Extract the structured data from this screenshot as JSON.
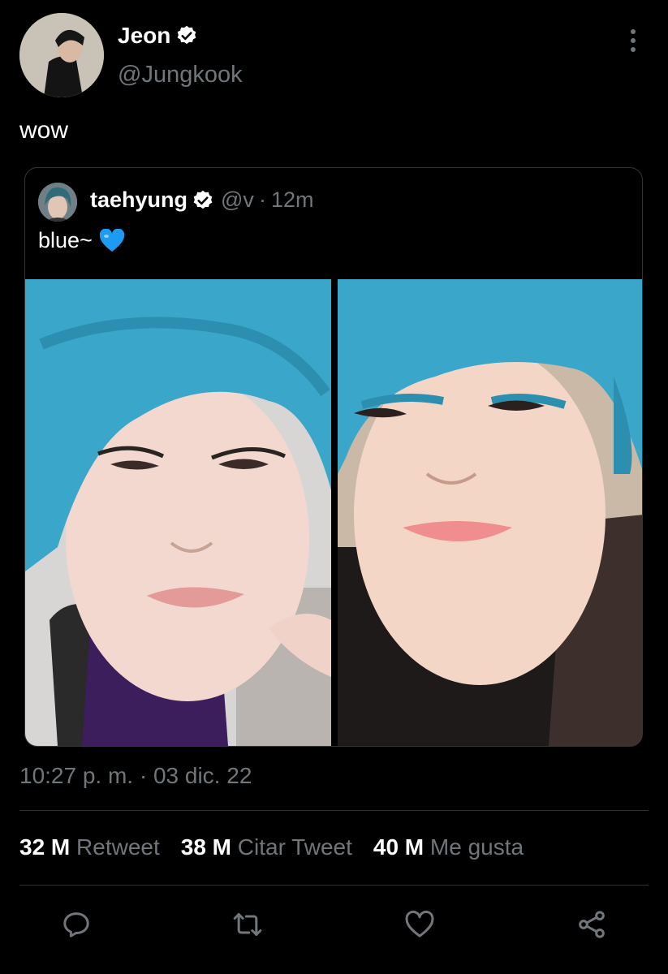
{
  "author": {
    "display_name": "Jeon",
    "handle": "@Jungkook",
    "verified_icon": "verified-badge-icon"
  },
  "tweet": {
    "text": "wow"
  },
  "quoted": {
    "display_name": "taehyung",
    "handle": "@v",
    "separator": "·",
    "age": "12m",
    "text": "blue~",
    "emoji": "💙"
  },
  "timestamp": "10:27 p. m. · 03 dic. 22",
  "stats": [
    {
      "count": "32 M",
      "label": "Retweet"
    },
    {
      "count": "38 M",
      "label": "Citar Tweet"
    },
    {
      "count": "40 M",
      "label": "Me gusta"
    }
  ],
  "actions": [
    "reply-icon",
    "retweet-icon",
    "like-icon",
    "share-icon"
  ],
  "colors": {
    "background": "#000000",
    "muted": "#71767b",
    "hair": "#3aa6c9",
    "heart": "#1d9bf0"
  }
}
